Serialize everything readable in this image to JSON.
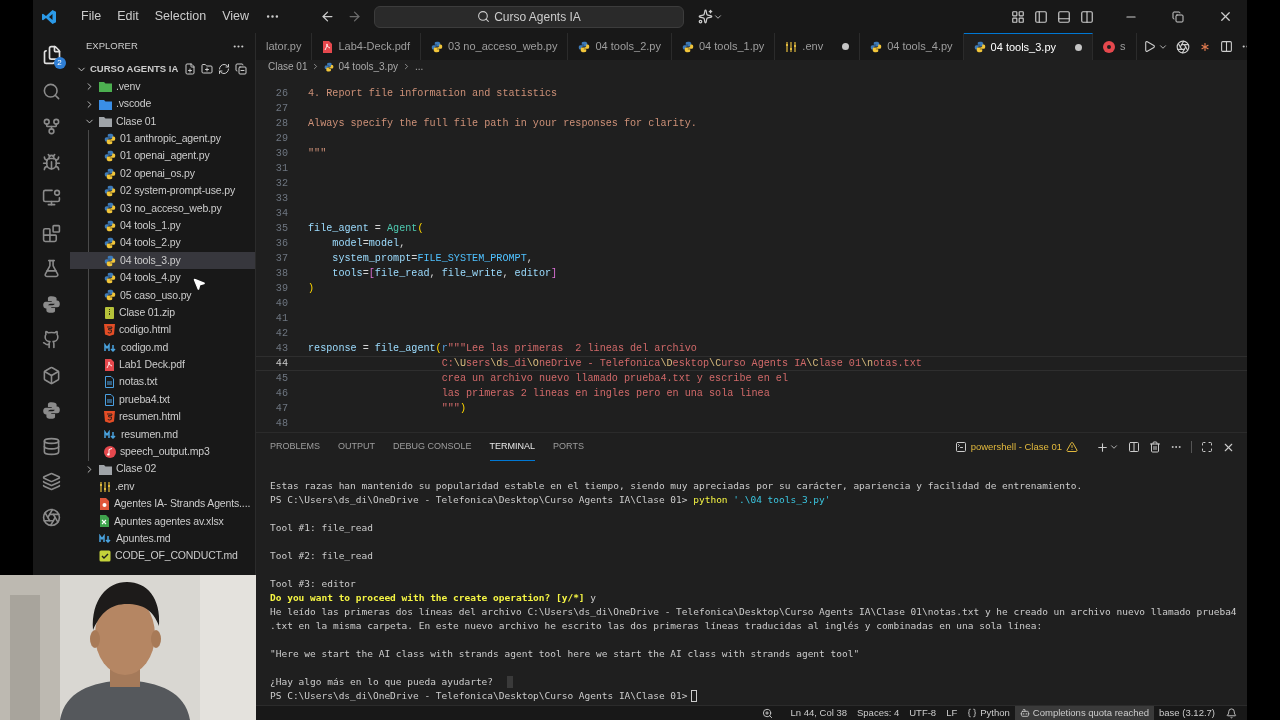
{
  "titlebar": {
    "menus": [
      "File",
      "Edit",
      "Selection",
      "View"
    ],
    "search": "Curso Agents IA"
  },
  "activity_bar": {
    "explorer_badge": "2"
  },
  "explorer": {
    "title": "EXPLORER",
    "root": {
      "label": "CURSO AGENTS IA",
      "expanded": true,
      "children": [
        {
          "label": ".venv",
          "kind": "venv",
          "expanded": false,
          "selected": false
        },
        {
          "label": ".vscode",
          "kind": "vscode",
          "expanded": false,
          "selected": false
        },
        {
          "label": "Clase 01",
          "kind": "folder",
          "expanded": true,
          "selected": false,
          "children": [
            {
              "label": "01 anthropic_agent.py",
              "kind": "py",
              "selected": false
            },
            {
              "label": "01 openai_agent.py",
              "kind": "py",
              "selected": false
            },
            {
              "label": "02 openai_os.py",
              "kind": "py",
              "selected": false
            },
            {
              "label": "02 system-prompt-use.py",
              "kind": "py",
              "selected": false
            },
            {
              "label": "03 no_acceso_web.py",
              "kind": "py",
              "selected": false
            },
            {
              "label": "04 tools_1.py",
              "kind": "py",
              "selected": false
            },
            {
              "label": "04 tools_2.py",
              "kind": "py",
              "selected": false
            },
            {
              "label": "04 tools_3.py",
              "kind": "py",
              "selected": true
            },
            {
              "label": "04 tools_4.py",
              "kind": "py",
              "selected": false
            },
            {
              "label": "05 caso_uso.py",
              "kind": "py",
              "selected": false
            },
            {
              "label": "Clase 01.zip",
              "kind": "zip",
              "selected": false
            },
            {
              "label": "codigo.html",
              "kind": "html",
              "selected": false
            },
            {
              "label": "codigo.md",
              "kind": "md",
              "selected": false
            },
            {
              "label": "Lab1 Deck.pdf",
              "kind": "pdf",
              "selected": false
            },
            {
              "label": "notas.txt",
              "kind": "txt",
              "selected": false
            },
            {
              "label": "prueba4.txt",
              "kind": "txt",
              "selected": false
            },
            {
              "label": "resumen.html",
              "kind": "html",
              "selected": false
            },
            {
              "label": "resumen.md",
              "kind": "md",
              "selected": false
            },
            {
              "label": "speech_output.mp3",
              "kind": "mp3",
              "selected": false
            }
          ]
        },
        {
          "label": "Clase 02",
          "kind": "folder",
          "expanded": false,
          "selected": false
        },
        {
          "label": ".env",
          "kind": "env",
          "selected": false
        },
        {
          "label": "Agentes IA- Strands Agents....",
          "kind": "ppt",
          "selected": false
        },
        {
          "label": "Apuntes agentes av.xlsx",
          "kind": "xlsx",
          "selected": false
        },
        {
          "label": "Apuntes.md",
          "kind": "md",
          "selected": false
        },
        {
          "label": "CODE_OF_CONDUCT.md",
          "kind": "check",
          "selected": false
        }
      ]
    }
  },
  "tabs": [
    {
      "label": "lator.py",
      "kind": "none",
      "modified": false,
      "selected": false
    },
    {
      "label": "Lab4-Deck.pdf",
      "kind": "pdf",
      "modified": false,
      "selected": false
    },
    {
      "label": "03 no_acceso_web.py",
      "kind": "py",
      "modified": false,
      "selected": false
    },
    {
      "label": "04 tools_2.py",
      "kind": "py",
      "modified": false,
      "selected": false
    },
    {
      "label": "04 tools_1.py",
      "kind": "py",
      "modified": false,
      "selected": false
    },
    {
      "label": ".env",
      "kind": "env",
      "modified": true,
      "selected": false
    },
    {
      "label": "04 tools_4.py",
      "kind": "py",
      "modified": false,
      "selected": false
    },
    {
      "label": "04 tools_3.py",
      "kind": "py",
      "modified": true,
      "selected": true
    },
    {
      "label": "s",
      "kind": "red",
      "modified": false,
      "selected": false
    }
  ],
  "breadcrumb": [
    "Clase 01",
    "04 tools_3.py",
    "..."
  ],
  "code_lines": [
    {
      "number": "26",
      "current": false,
      "tokens": [
        {
          "text": "4. Report file information and statistics",
          "kind": "str"
        }
      ]
    },
    {
      "number": "27",
      "current": false
    },
    {
      "number": "28",
      "current": false,
      "tokens": [
        {
          "text": "Always specify the full file path in your responses for clarity.",
          "kind": "str"
        }
      ]
    },
    {
      "number": "29",
      "current": false
    },
    {
      "number": "30",
      "current": false,
      "tokens": [
        {
          "text": "\"\"\"",
          "kind": "str"
        }
      ]
    },
    {
      "number": "31",
      "current": false
    },
    {
      "number": "32",
      "current": false
    },
    {
      "number": "33",
      "current": false
    },
    {
      "number": "34",
      "current": false
    },
    {
      "number": "35",
      "current": false,
      "tokens": [
        {
          "text": "file_agent",
          "kind": "var"
        },
        {
          "text": " = ",
          "kind": "op"
        },
        {
          "text": "Agent",
          "kind": "cls"
        },
        {
          "text": "(",
          "kind": "b1"
        }
      ]
    },
    {
      "number": "36",
      "current": false,
      "tokens": [
        {
          "text": "    model",
          "kind": "var"
        },
        {
          "text": "=",
          "kind": "op"
        },
        {
          "text": "model",
          "kind": "var"
        },
        {
          "text": ",",
          "kind": "op"
        }
      ]
    },
    {
      "number": "37",
      "current": false,
      "tokens": [
        {
          "text": "    system_prompt",
          "kind": "var"
        },
        {
          "text": "=",
          "kind": "op"
        },
        {
          "text": "FILE_SYSTEM_PROMPT",
          "kind": "const"
        },
        {
          "text": ",",
          "kind": "op"
        }
      ]
    },
    {
      "number": "38",
      "current": false,
      "tokens": [
        {
          "text": "    tools",
          "kind": "var"
        },
        {
          "text": "=",
          "kind": "op"
        },
        {
          "text": "[",
          "kind": "b2"
        },
        {
          "text": "file_read",
          "kind": "var"
        },
        {
          "text": ", ",
          "kind": "op"
        },
        {
          "text": "file_write",
          "kind": "var"
        },
        {
          "text": ", ",
          "kind": "op"
        },
        {
          "text": "editor",
          "kind": "var"
        },
        {
          "text": "]",
          "kind": "b2"
        }
      ]
    },
    {
      "number": "39",
      "current": false,
      "tokens": [
        {
          "text": ")",
          "kind": "b1"
        }
      ]
    },
    {
      "number": "40",
      "current": false
    },
    {
      "number": "41",
      "current": false
    },
    {
      "number": "42",
      "current": false
    },
    {
      "number": "43",
      "current": false,
      "tokens": [
        {
          "text": "response",
          "kind": "var"
        },
        {
          "text": " = ",
          "kind": "op"
        },
        {
          "text": "file_agent",
          "kind": "var"
        },
        {
          "text": "(",
          "kind": "b1"
        },
        {
          "text": "r",
          "kind": "kw"
        },
        {
          "text": "\"\"\"Lee las primeras  2 lineas del archivo",
          "kind": "rstr"
        }
      ]
    },
    {
      "number": "44",
      "current": true,
      "tokens": [
        {
          "text": "                      C:",
          "kind": "rstr"
        },
        {
          "text": "\\U",
          "kind": "esc"
        },
        {
          "text": "sers",
          "kind": "rstr"
        },
        {
          "text": "\\d",
          "kind": "esc"
        },
        {
          "text": "s_di",
          "kind": "rstr"
        },
        {
          "text": "\\O",
          "kind": "esc"
        },
        {
          "text": "neDrive - Telefonica",
          "kind": "rstr"
        },
        {
          "text": "\\D",
          "kind": "esc"
        },
        {
          "text": "esktop",
          "kind": "rstr"
        },
        {
          "text": "\\C",
          "kind": "esc"
        },
        {
          "text": "urso Agents IA",
          "kind": "rstr"
        },
        {
          "text": "\\C",
          "kind": "esc"
        },
        {
          "text": "lase 01",
          "kind": "rstr"
        },
        {
          "text": "\\n",
          "kind": "esc"
        },
        {
          "text": "otas.txt",
          "kind": "rstr"
        }
      ]
    },
    {
      "number": "45",
      "current": false,
      "tokens": [
        {
          "text": "                      crea un archivo nuevo llamado prueba4.txt y escribe en el",
          "kind": "rstr"
        }
      ]
    },
    {
      "number": "46",
      "current": false,
      "tokens": [
        {
          "text": "                      las primeras 2 lineas en ingles pero en una sola linea",
          "kind": "rstr"
        }
      ]
    },
    {
      "number": "47",
      "current": false,
      "tokens": [
        {
          "text": "                      \"\"\"",
          "kind": "rstr"
        },
        {
          "text": ")",
          "kind": "b1"
        }
      ]
    },
    {
      "number": "48",
      "current": false
    }
  ],
  "panel": {
    "tabs": [
      {
        "label": "PROBLEMS",
        "selected": false
      },
      {
        "label": "OUTPUT",
        "selected": false
      },
      {
        "label": "DEBUG CONSOLE",
        "selected": false
      },
      {
        "label": "TERMINAL",
        "selected": true
      },
      {
        "label": "PORTS",
        "selected": false
      }
    ],
    "terminal_name": "powershell - Clase 01",
    "lines": [
      {
        "kind": "text",
        "segments": [
          {
            "text": "Estas razas han mantenido su popularidad estable en el tiempo, siendo muy apreciadas por su carácter, apariencia y facilidad de entrenamiento.",
            "kind": "plain"
          }
        ]
      },
      {
        "kind": "text",
        "segments": [
          {
            "text": "PS C:\\Users\\ds_di\\OneDrive - Telefonica\\Desktop\\Curso Agents IA\\Clase 01> ",
            "kind": "plain"
          },
          {
            "text": "python",
            "kind": "cmd"
          },
          {
            "text": " '.\\04 tools_3.py'",
            "kind": "arg"
          }
        ]
      },
      {
        "kind": "blank"
      },
      {
        "kind": "text",
        "segments": [
          {
            "text": "Tool #1: file_read",
            "kind": "plain"
          }
        ]
      },
      {
        "kind": "blank"
      },
      {
        "kind": "text",
        "segments": [
          {
            "text": "Tool #2: file_read",
            "kind": "plain"
          }
        ]
      },
      {
        "kind": "blank"
      },
      {
        "kind": "text",
        "segments": [
          {
            "text": "Tool #3: editor",
            "kind": "plain"
          }
        ]
      },
      {
        "kind": "text",
        "segments": [
          {
            "text": "Do you want to proceed with the create operation? [y/*]",
            "kind": "question"
          },
          {
            "text": " y",
            "kind": "plain"
          }
        ]
      },
      {
        "kind": "text",
        "segments": [
          {
            "text": "He leído las primeras dos líneas del archivo C:\\Users\\ds_di\\OneDrive - Telefonica\\Desktop\\Curso Agents IA\\Clase 01\\notas.txt y he creado un archivo nuevo llamado prueba4",
            "kind": "plain"
          }
        ]
      },
      {
        "kind": "text",
        "segments": [
          {
            "text": ".txt en la misma carpeta. En este nuevo archivo he escrito las dos primeras líneas traducidas al inglés y combinadas en una sola línea:",
            "kind": "plain"
          }
        ]
      },
      {
        "kind": "blank"
      },
      {
        "kind": "text",
        "segments": [
          {
            "text": "\"Here we start the AI class with strands agent tool here we start the AI class with strands agent tool\"",
            "kind": "plain"
          }
        ]
      },
      {
        "kind": "blank"
      },
      {
        "kind": "ghost_cursor",
        "segments": [
          {
            "text": "¿Hay algo más en lo que pueda ayudarte?",
            "kind": "plain"
          }
        ]
      },
      {
        "kind": "active_cursor",
        "segments": [
          {
            "text": "PS C:\\Users\\ds_di\\OneDrive - Telefonica\\Desktop\\Curso Agents IA\\Clase 01>",
            "kind": "plain"
          }
        ]
      }
    ]
  },
  "status_bar": [
    {
      "text": "Ln 44, Col 38",
      "kind": "plain",
      "highlighted": false
    },
    {
      "text": "Spaces: 4",
      "kind": "plain",
      "highlighted": false
    },
    {
      "text": "UTF-8",
      "kind": "plain",
      "highlighted": false
    },
    {
      "text": "LF",
      "kind": "plain",
      "highlighted": false
    },
    {
      "text": "Python",
      "kind": "braces",
      "highlighted": false
    },
    {
      "text": "Completions quota reached",
      "kind": "copilot",
      "highlighted": true
    },
    {
      "text": "base (3.12.7)",
      "kind": "plain",
      "highlighted": false
    }
  ]
}
